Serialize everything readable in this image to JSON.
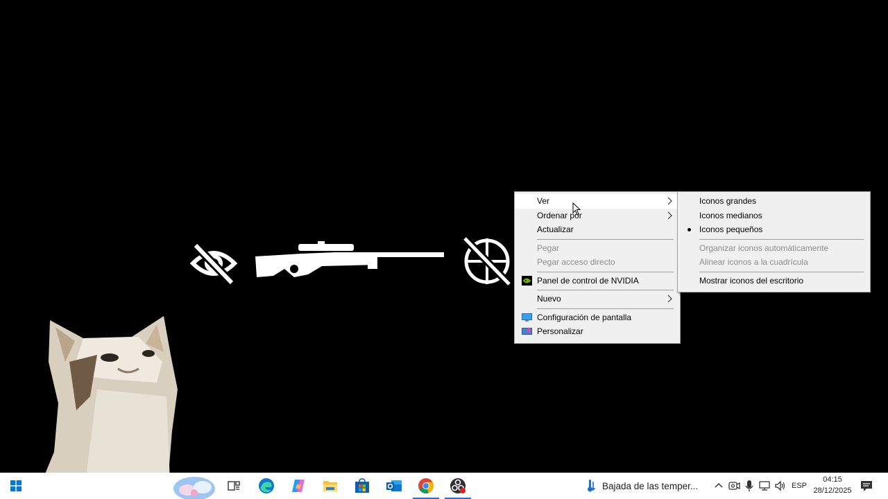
{
  "desktop": {
    "wallpaper_icons": [
      "eye-slash-icon",
      "sniper-rifle-icon",
      "crosshair-slash-icon",
      "cat-meme"
    ]
  },
  "context_menu": {
    "items": [
      {
        "label": "Ver",
        "submenu": true,
        "state": "hover"
      },
      {
        "label": "Ordenar por",
        "submenu": true
      },
      {
        "label": "Actualizar"
      },
      {
        "label": "Pegar",
        "disabled": true
      },
      {
        "label": "Pegar acceso directo",
        "disabled": true
      },
      {
        "label": "Panel de control de NVIDIA",
        "icon": "nvidia-icon"
      },
      {
        "label": "Nuevo",
        "submenu": true
      },
      {
        "label": "Configuración de pantalla",
        "icon": "display-icon"
      },
      {
        "label": "Personalizar",
        "icon": "personalize-icon"
      }
    ]
  },
  "view_submenu": {
    "items": [
      {
        "label": "Iconos grandes"
      },
      {
        "label": "Iconos medianos"
      },
      {
        "label": "Iconos pequeños",
        "selected": true
      },
      {
        "label": "Organizar iconos automáticamente",
        "disabled": true
      },
      {
        "label": "Alinear iconos a la cuadrícula",
        "disabled": true
      },
      {
        "label": "Mostrar iconos del escritorio"
      }
    ]
  },
  "taskbar": {
    "apps": [
      "task-view-icon",
      "edge-icon",
      "copilot-icon",
      "file-explorer-icon",
      "microsoft-store-icon",
      "outlook-icon",
      "chrome-icon",
      "obs-icon"
    ],
    "active_app": "chrome-icon",
    "weather_text": "Bajada de las temper...",
    "language": "ESP",
    "time": "04:15",
    "date": "28/12/2025",
    "colors": {
      "accent": "#1a73e8",
      "menu_bg": "#f0f0f0",
      "taskbar_bg": "#ffffff"
    }
  }
}
